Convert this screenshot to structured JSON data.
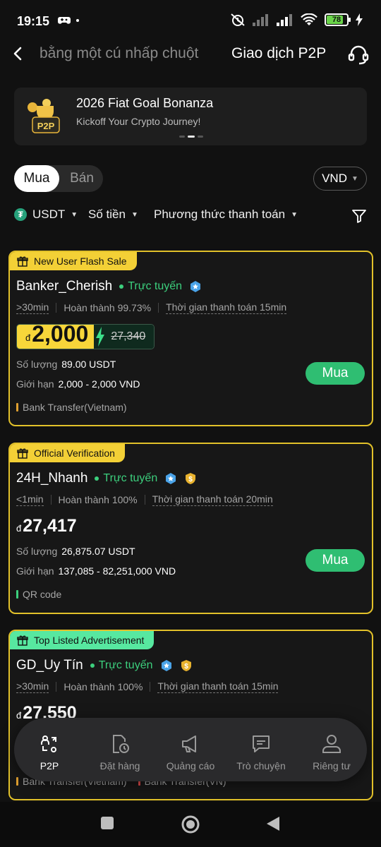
{
  "status_bar": {
    "time": "19:15",
    "battery": "78"
  },
  "header": {
    "scroll_text": "bằng một cú nhấp chuột",
    "title": "Giao dịch P2P"
  },
  "banner": {
    "title": "2026 Fiat Goal Bonanza",
    "subtitle": "Kickoff Your Crypto Journey!",
    "art_label": "P2P"
  },
  "side_toggle": {
    "buy": "Mua",
    "sell": "Bán"
  },
  "currency": "VND",
  "filters": {
    "asset": "USDT",
    "amount": "Số tiền",
    "payment": "Phương thức thanh toán"
  },
  "labels": {
    "quantity": "Số lượng",
    "limit": "Giới hạn",
    "buy_button": "Mua",
    "currency_symbol": "đ"
  },
  "ads": [
    {
      "tag": "New User Flash Sale",
      "merchant": "Banker_Cherish",
      "status": "Trực tuyến",
      "response_time": ">30min",
      "completion": "Hoàn thành 99.73%",
      "payment_time": "Thời gian thanh toán 15min",
      "price": "2,000",
      "old_price": "27,340",
      "quantity": "89.00 USDT",
      "limit": "2,000 - 2,000 VND",
      "payment_method": "Bank Transfer(Vietnam)"
    },
    {
      "tag": "Official Verification",
      "merchant": "24H_Nhanh",
      "status": "Trực tuyến",
      "response_time": "<1min",
      "completion": "Hoàn thành 100%",
      "payment_time": "Thời gian thanh toán 20min",
      "price": "27,417",
      "quantity": "26,875.07 USDT",
      "limit": "137,085 - 82,251,000 VND",
      "payment_method": "QR code"
    },
    {
      "tag": "Top Listed Advertisement",
      "merchant": "GD_Uy Tín",
      "status": "Trực tuyến",
      "response_time": ">30min",
      "completion": "Hoàn thành 100%",
      "payment_time": "Thời gian thanh toán 15min",
      "price": "27,550",
      "payment_method": "Bank Transfer(Vietnam)",
      "payment_method_2": "Bank Transfer(VN)"
    }
  ],
  "bottom_nav": [
    {
      "label": "P2P",
      "icon": "p2p-icon"
    },
    {
      "label": "Đặt hàng",
      "icon": "orders-icon"
    },
    {
      "label": "Quảng cáo",
      "icon": "megaphone-icon"
    },
    {
      "label": "Trò chuyện",
      "icon": "chat-icon"
    },
    {
      "label": "Riêng tư",
      "icon": "user-icon"
    }
  ],
  "colors": {
    "accent_green": "#2fbe72",
    "tag_yellow": "#f3d036",
    "tag_green": "#57e8a0",
    "card_border": "#e2c12a"
  }
}
